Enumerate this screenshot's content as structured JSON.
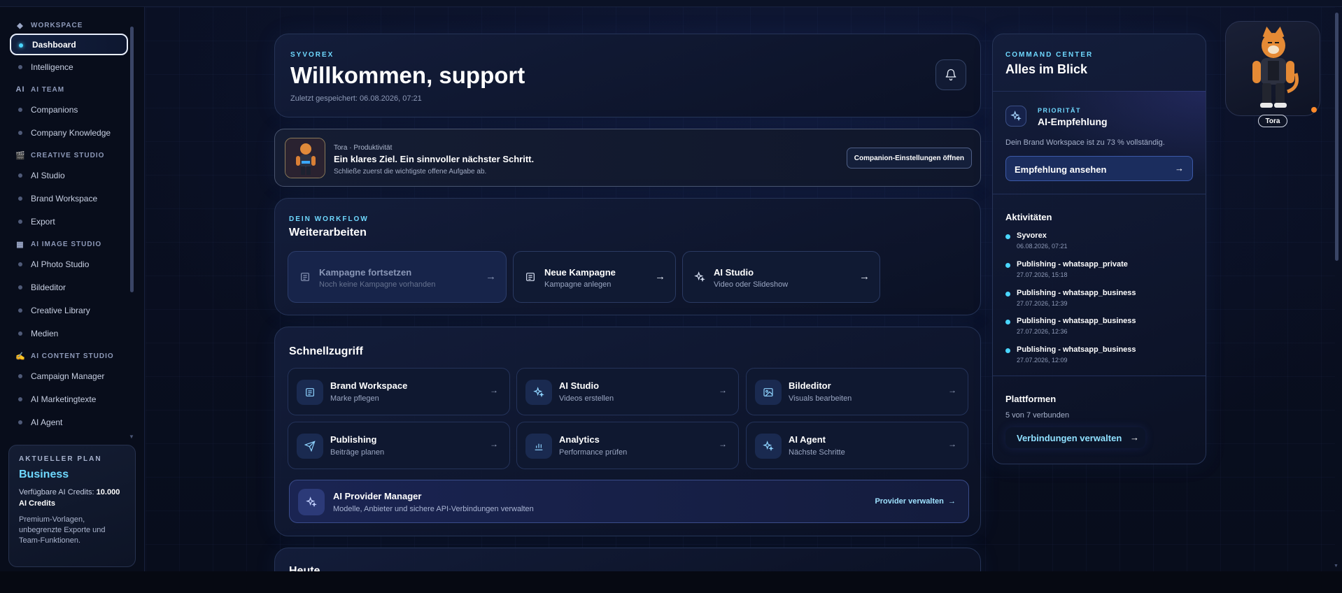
{
  "sidebar": {
    "sections": [
      {
        "label": "WORKSPACE",
        "icon": "diamond-icon",
        "items": [
          {
            "label": "Dashboard",
            "active": true
          },
          {
            "label": "Intelligence"
          }
        ]
      },
      {
        "label": "AI TEAM",
        "icon": "ai-icon",
        "items": [
          {
            "label": "Companions"
          },
          {
            "label": "Company Knowledge"
          }
        ]
      },
      {
        "label": "CREATIVE STUDIO",
        "icon": "clapper-icon",
        "items": [
          {
            "label": "AI Studio"
          },
          {
            "label": "Brand Workspace"
          },
          {
            "label": "Export"
          }
        ]
      },
      {
        "label": "AI IMAGE STUDIO",
        "icon": "image-icon",
        "items": [
          {
            "label": "AI Photo Studio"
          },
          {
            "label": "Bildeditor"
          },
          {
            "label": "Creative Library"
          },
          {
            "label": "Medien"
          }
        ]
      },
      {
        "label": "AI CONTENT STUDIO",
        "icon": "writing-hand-icon",
        "items": [
          {
            "label": "Campaign Manager"
          },
          {
            "label": "AI Marketingtexte"
          },
          {
            "label": "AI Agent"
          }
        ]
      }
    ],
    "plan": {
      "kicker": "AKTUELLER PLAN",
      "name": "Business",
      "credits_prefix": "Verfügbare AI Credits: ",
      "credits_value": "10.000 AI Credits",
      "description": "Premium-Vorlagen, unbegrenzte Exporte und Team-Funktionen."
    }
  },
  "welcome": {
    "kicker": "SYVOREX",
    "title": "Willkommen, support",
    "saved": "Zuletzt gespeichert: 06.08.2026, 07:21"
  },
  "companion": {
    "meta": "Tora · Produktivität",
    "title": "Ein klares Ziel. Ein sinnvoller nächster Schritt.",
    "subtitle": "Schließe zuerst die wichtigste offene Aufgabe ab.",
    "button": "Companion-Einstellungen öffnen"
  },
  "workflow": {
    "kicker": "DEIN WORKFLOW",
    "title": "Weiterarbeiten",
    "cards": [
      {
        "title": "Kampagne fortsetzen",
        "subtitle": "Noch keine Kampagne vorhanden",
        "icon": "document-icon",
        "disabled": true
      },
      {
        "title": "Neue Kampagne",
        "subtitle": "Kampagne anlegen",
        "icon": "document-icon"
      },
      {
        "title": "AI Studio",
        "subtitle": "Video oder Slideshow",
        "icon": "sparkles-icon"
      }
    ]
  },
  "quick": {
    "title": "Schnellzugriff",
    "cards": [
      {
        "title": "Brand Workspace",
        "subtitle": "Marke pflegen",
        "icon": "document-icon"
      },
      {
        "title": "AI Studio",
        "subtitle": "Videos erstellen",
        "icon": "sparkles-icon"
      },
      {
        "title": "Bildeditor",
        "subtitle": "Visuals bearbeiten",
        "icon": "image-icon"
      },
      {
        "title": "Publishing",
        "subtitle": "Beiträge planen",
        "icon": "send-icon"
      },
      {
        "title": "Analytics",
        "subtitle": "Performance prüfen",
        "icon": "bar-chart-icon"
      },
      {
        "title": "AI Agent",
        "subtitle": "Nächste Schritte",
        "icon": "sparkles-icon"
      }
    ],
    "provider": {
      "title": "AI Provider Manager",
      "subtitle": "Modelle, Anbieter und sichere API-Verbindungen verwalten",
      "link": "Provider verwalten"
    }
  },
  "heute": {
    "title": "Heute"
  },
  "command": {
    "kicker": "COMMAND CENTER",
    "title": "Alles im Blick",
    "priority": {
      "kicker": "PRIORITÄT",
      "title": "AI-Empfehlung",
      "description": "Dein Brand Workspace ist zu 73 % vollständig.",
      "button": "Empfehlung ansehen"
    },
    "activities_title": "Aktivitäten",
    "activities": [
      {
        "title": "Syvorex",
        "time": "06.08.2026, 07:21"
      },
      {
        "title": "Publishing - whatsapp_private",
        "time": "27.07.2026, 15:18"
      },
      {
        "title": "Publishing - whatsapp_business",
        "time": "27.07.2026, 12:39"
      },
      {
        "title": "Publishing - whatsapp_business",
        "time": "27.07.2026, 12:36"
      },
      {
        "title": "Publishing - whatsapp_business",
        "time": "27.07.2026, 12:09"
      }
    ],
    "platforms_title": "Plattformen",
    "platforms_status": "5 von 7 verbunden",
    "platforms_button": "Verbindungen verwalten"
  },
  "companion_badge": {
    "name": "Tora"
  },
  "colors": {
    "accent": "#6fd9ff",
    "active_dot": "#4ad6ff",
    "background": "#090e1e"
  }
}
